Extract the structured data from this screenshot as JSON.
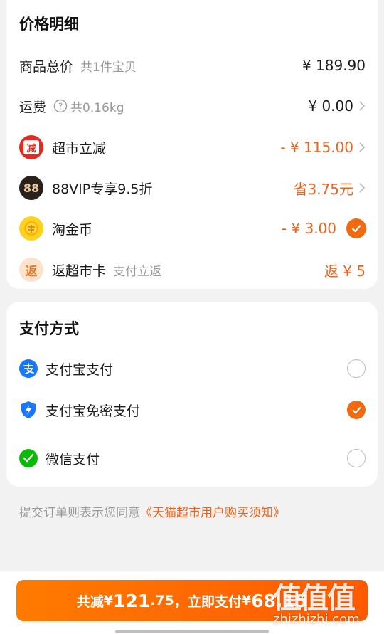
{
  "price_detail": {
    "title": "价格明细",
    "goods_total": {
      "label": "商品总价",
      "sub": "共1件宝贝",
      "value": "¥ 189.90"
    },
    "shipping": {
      "label": "运费",
      "sub": "共0.16kg",
      "value": "¥ 0.00"
    },
    "supermarket_discount": {
      "label": "超市立减",
      "value": "- ¥ 115.00",
      "icon_text": "减"
    },
    "vip": {
      "label": "88VIP专享9.5折",
      "value": "省3.75元",
      "icon_text": "88"
    },
    "taojinbi": {
      "label": "淘金币",
      "value": "- ¥ 3.00"
    },
    "return_card": {
      "label": "返超市卡",
      "sub": "支付立返",
      "value": "返 ¥ 5",
      "icon_text": "返"
    }
  },
  "payment": {
    "title": "支付方式",
    "methods": [
      {
        "label": "支付宝支付",
        "selected": false,
        "icon": "alipay-icon"
      },
      {
        "label": "支付宝免密支付",
        "selected": true,
        "icon": "alipay-shield-icon"
      },
      {
        "label": "微信支付",
        "selected": false,
        "icon": "wechat-pay-icon"
      }
    ]
  },
  "agreement": {
    "prefix": "提交订单则表示您同意",
    "link": "《天猫超市用户购买须知》"
  },
  "submit": {
    "prefix": "共减",
    "currency": "¥",
    "saved": "121",
    "saved_decimal": ".75",
    "middle": "，立即支付",
    "pay_currency": "¥",
    "pay_amount": "68.15"
  },
  "watermark": {
    "logo": "值值值",
    "url": "zhizhizhi.com"
  },
  "colors": {
    "accent": "#f26a10",
    "orange_text": "#f0611b",
    "background": "#f2f2f2"
  }
}
